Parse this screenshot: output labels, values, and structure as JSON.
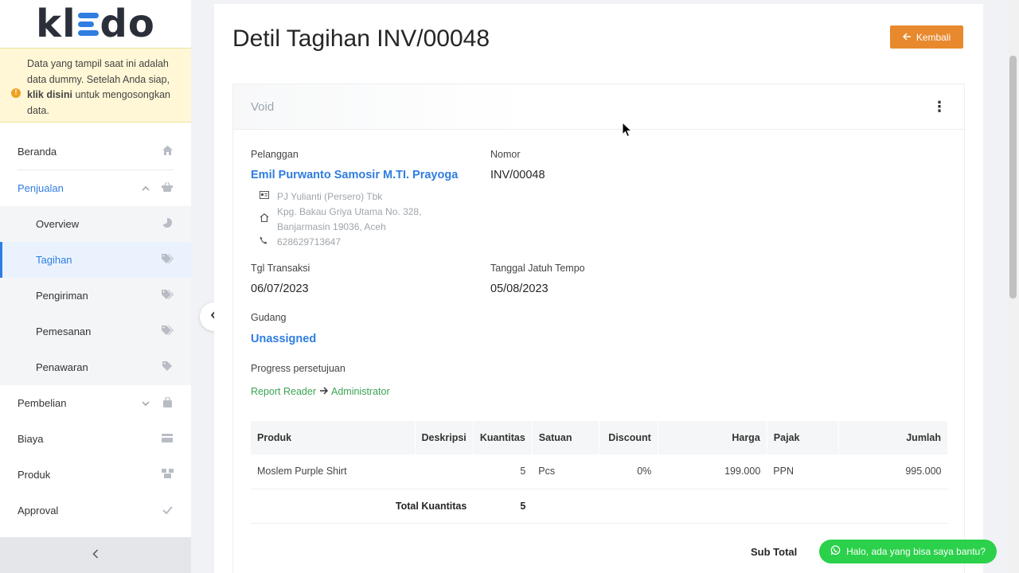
{
  "logo": "kledo",
  "notice": {
    "text_before": "Data yang tampil saat ini adalah data dummy. Setelah Anda siap, ",
    "link": "klik disini",
    "text_after": " untuk mengosongkan data."
  },
  "menu": {
    "beranda": "Beranda",
    "penjualan": "Penjualan",
    "sub": {
      "overview": "Overview",
      "tagihan": "Tagihan",
      "pengiriman": "Pengiriman",
      "pemesanan": "Pemesanan",
      "penawaran": "Penawaran"
    },
    "pembelian": "Pembelian",
    "biaya": "Biaya",
    "produk": "Produk",
    "approval": "Approval"
  },
  "page": {
    "title": "Detil Tagihan INV/00048",
    "back_label": "Kembali",
    "status": "Void"
  },
  "detail": {
    "customer_label": "Pelanggan",
    "customer_name": "Emil Purwanto Samosir M.TI. Prayoga",
    "company": "PJ Yulianti (Persero) Tbk",
    "address_line1": "Kpg. Bakau Griya Utama No. 328,",
    "address_line2": "Banjarmasin 19036, Aceh",
    "phone": "628629713647",
    "number_label": "Nomor",
    "number": "INV/00048",
    "trx_date_label": "Tgl Transaksi",
    "trx_date": "06/07/2023",
    "due_date_label": "Tanggal Jatuh Tempo",
    "due_date": "05/08/2023",
    "warehouse_label": "Gudang",
    "warehouse": "Unassigned",
    "approval_label": "Progress persetujuan",
    "approval_from": "Report Reader",
    "approval_to": "Administrator"
  },
  "table": {
    "headers": [
      "Produk",
      "Deskripsi",
      "Kuantitas",
      "Satuan",
      "Discount",
      "Harga",
      "Pajak",
      "Jumlah"
    ],
    "rows": [
      {
        "produk": "Moslem Purple Shirt",
        "deskripsi": "",
        "kuantitas": "5",
        "satuan": "Pcs",
        "discount": "0%",
        "harga": "199.000",
        "pajak": "PPN",
        "jumlah": "995.000"
      }
    ],
    "total_label": "Total Kuantitas",
    "total_value": "5"
  },
  "subtotal_label": "Sub Total",
  "chat_label": "Halo, ada yang bisa saya bantu?",
  "colors": {
    "accent": "#2f7de1",
    "orange": "#e8892e",
    "green": "#3ca352",
    "whatsapp": "#2bd14a"
  },
  "icons": [
    "home-icon",
    "basket-icon",
    "pie-chart-icon",
    "tag-icon",
    "credit-card-icon",
    "boxes-icon",
    "check-icon",
    "arrow-left-icon",
    "chevron-left-icon",
    "kebab-icon",
    "id-card-icon",
    "home-address-icon",
    "phone-icon",
    "whatsapp-icon"
  ]
}
